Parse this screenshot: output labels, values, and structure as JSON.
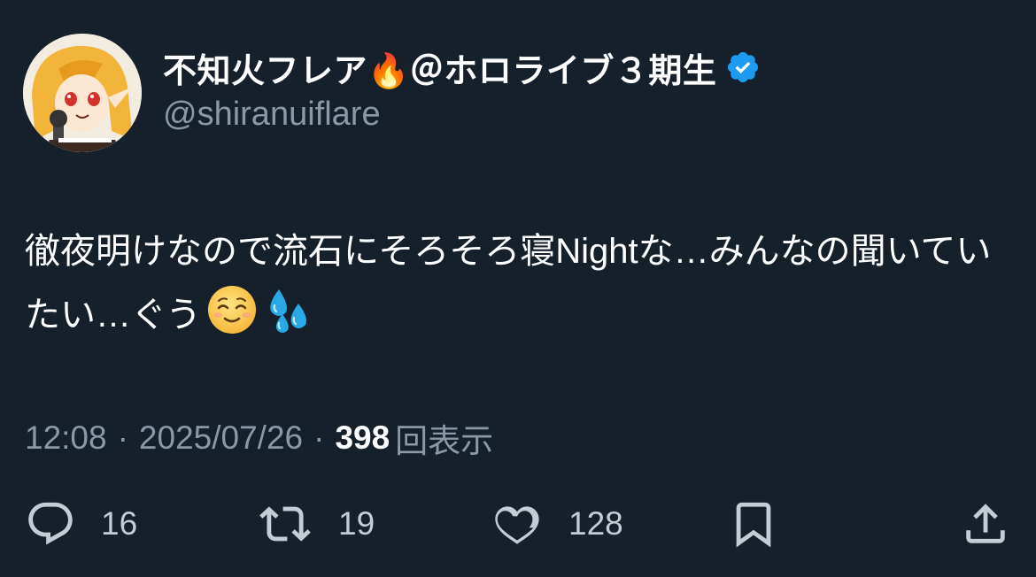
{
  "author": {
    "display_name": "不知火フレア🔥＠ホロライブ３期生",
    "handle": "@shiranuiflare",
    "verified": true,
    "verified_color": "#1d9bf0"
  },
  "tweet": {
    "text": "徹夜明けなので流石にそろそろ寝Nightな…みんなの聞いていたい…ぐう",
    "emojis": [
      "relieved-face",
      "sweat-droplets"
    ]
  },
  "meta": {
    "time": "12:08",
    "separator": "·",
    "date": "2025/07/26",
    "views_count": "398",
    "views_label": "回表示"
  },
  "actions": {
    "replies": "16",
    "retweets": "19",
    "likes": "128"
  },
  "colors": {
    "background": "#15202b",
    "muted_text": "#8b98a5",
    "primary_text": "#ffffff"
  }
}
